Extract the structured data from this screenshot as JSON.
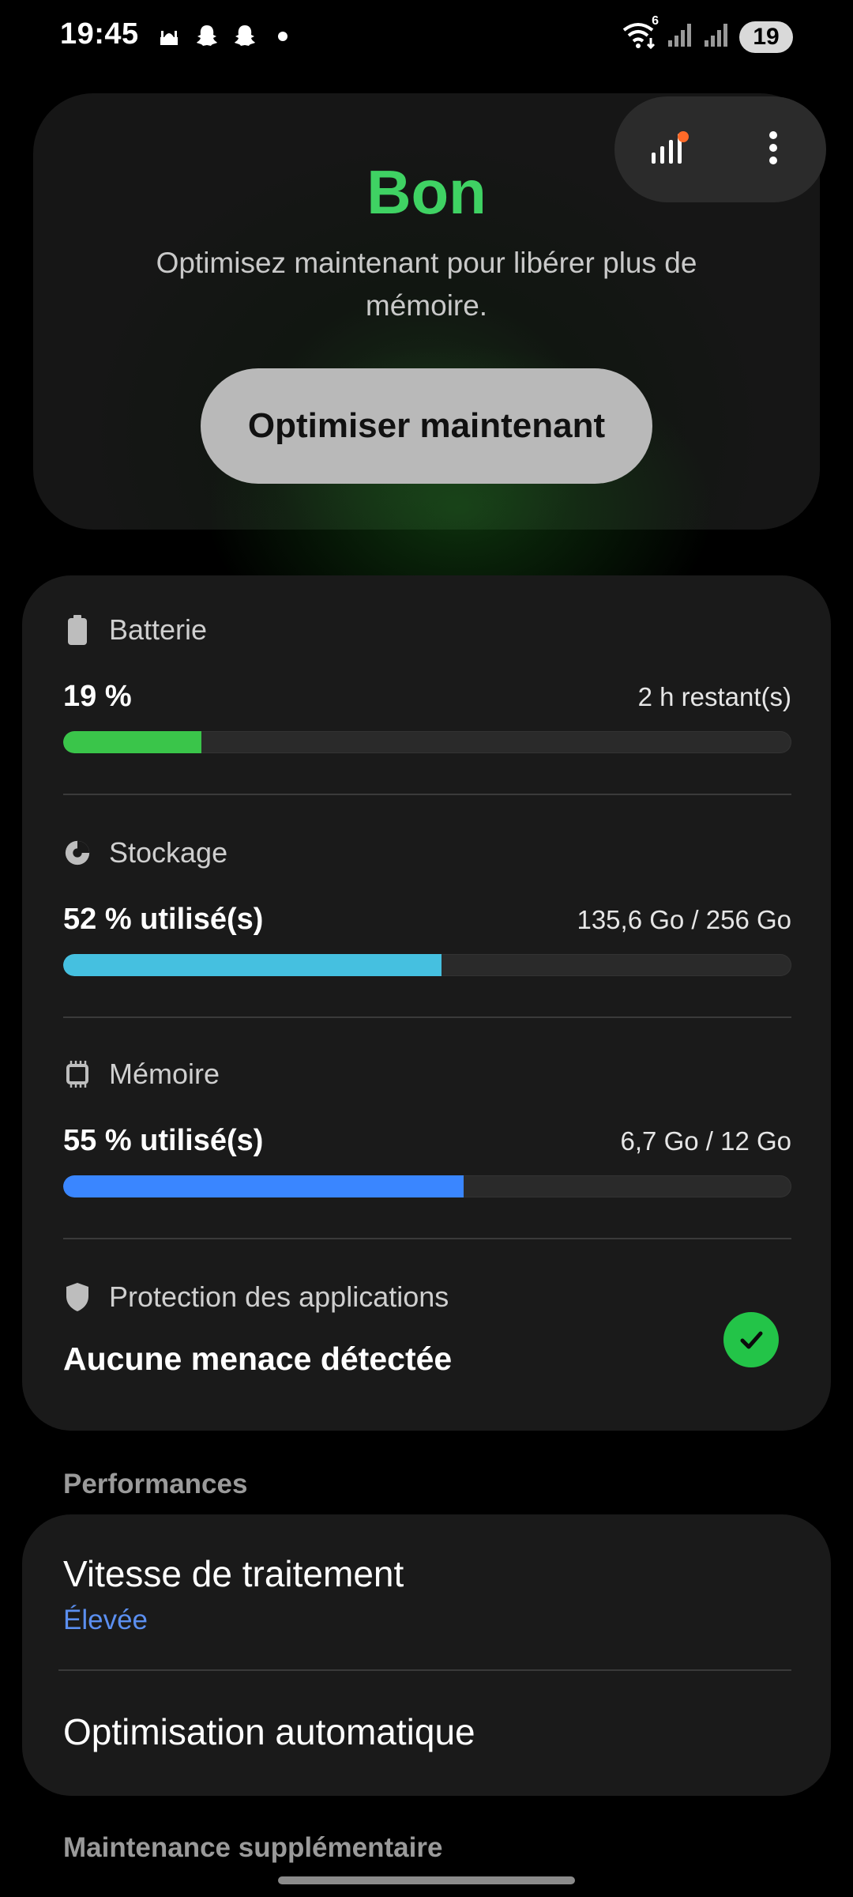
{
  "status_bar": {
    "time": "19:45",
    "battery_level": "19",
    "left_icons": [
      "mosque-notification-icon",
      "snapchat-icon",
      "snapchat-icon",
      "more-dot-icon"
    ],
    "right_icons": [
      "wifi-icon",
      "cell-signal-icon",
      "cell-signal-icon"
    ],
    "wifi_badge": "6"
  },
  "hero": {
    "status": "Bon",
    "subtitle": "Optimisez maintenant pour libérer plus de mémoire.",
    "button_label": "Optimiser maintenant",
    "status_color": "#3fd263"
  },
  "floating_actions": {
    "items": [
      {
        "icon": "signal-bars-icon",
        "has_badge": true
      },
      {
        "icon": "more-vertical-icon"
      }
    ]
  },
  "stats": {
    "battery": {
      "label": "Batterie",
      "value": "19 %",
      "detail": "2 h restant(s)",
      "percent": 19,
      "color": "#3ac54a"
    },
    "storage": {
      "label": "Stockage",
      "value": "52 % utilisé(s)",
      "detail": "135,6 Go / 256 Go",
      "percent": 52,
      "color": "#45c0e0"
    },
    "memory": {
      "label": "Mémoire",
      "value": "55 % utilisé(s)",
      "detail": "6,7 Go / 12 Go",
      "percent": 55,
      "color": "#3a86ff"
    },
    "protection": {
      "label": "Protection des applications",
      "value": "Aucune menace détectée"
    }
  },
  "performances": {
    "title": "Performances",
    "items": [
      {
        "title": "Vitesse de traitement",
        "subtitle": "Élevée"
      },
      {
        "title": "Optimisation automatique"
      }
    ]
  },
  "maintenance": {
    "title": "Maintenance supplémentaire"
  }
}
